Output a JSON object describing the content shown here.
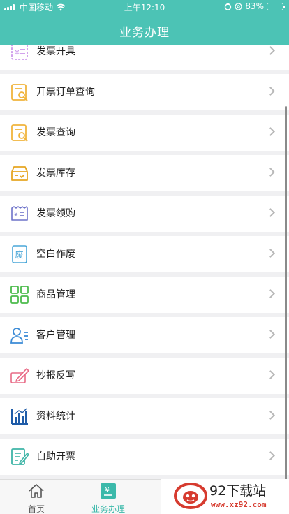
{
  "status_bar": {
    "carrier": "中国移动",
    "time": "上午12:10",
    "battery": "83%",
    "battery_level": 0.83
  },
  "header": {
    "title": "业务办理"
  },
  "menu": [
    {
      "label": "发票开具",
      "icon": "invoice-issue-icon"
    },
    {
      "label": "开票订单查询",
      "icon": "order-search-icon"
    },
    {
      "label": "发票查询",
      "icon": "invoice-search-icon"
    },
    {
      "label": "发票库存",
      "icon": "inventory-box-icon"
    },
    {
      "label": "发票领购",
      "icon": "invoice-purchase-icon"
    },
    {
      "label": "空白作废",
      "icon": "void-icon"
    },
    {
      "label": "商品管理",
      "icon": "grid-icon"
    },
    {
      "label": "客户管理",
      "icon": "customer-icon"
    },
    {
      "label": "抄报反写",
      "icon": "pen-icon"
    },
    {
      "label": "资料统计",
      "icon": "bar-chart-icon"
    },
    {
      "label": "自助开票",
      "icon": "edit-document-icon"
    }
  ],
  "tabbar": {
    "home": {
      "label": "首页",
      "icon": "home-icon"
    },
    "business": {
      "label": "业务办理",
      "icon": "business-yen-icon",
      "active": true
    }
  },
  "watermark": {
    "brand": "92下载站",
    "site": "www.xz92.com"
  },
  "colors": {
    "header": "#4cc3b5",
    "active_tab": "#3bb9aa"
  }
}
